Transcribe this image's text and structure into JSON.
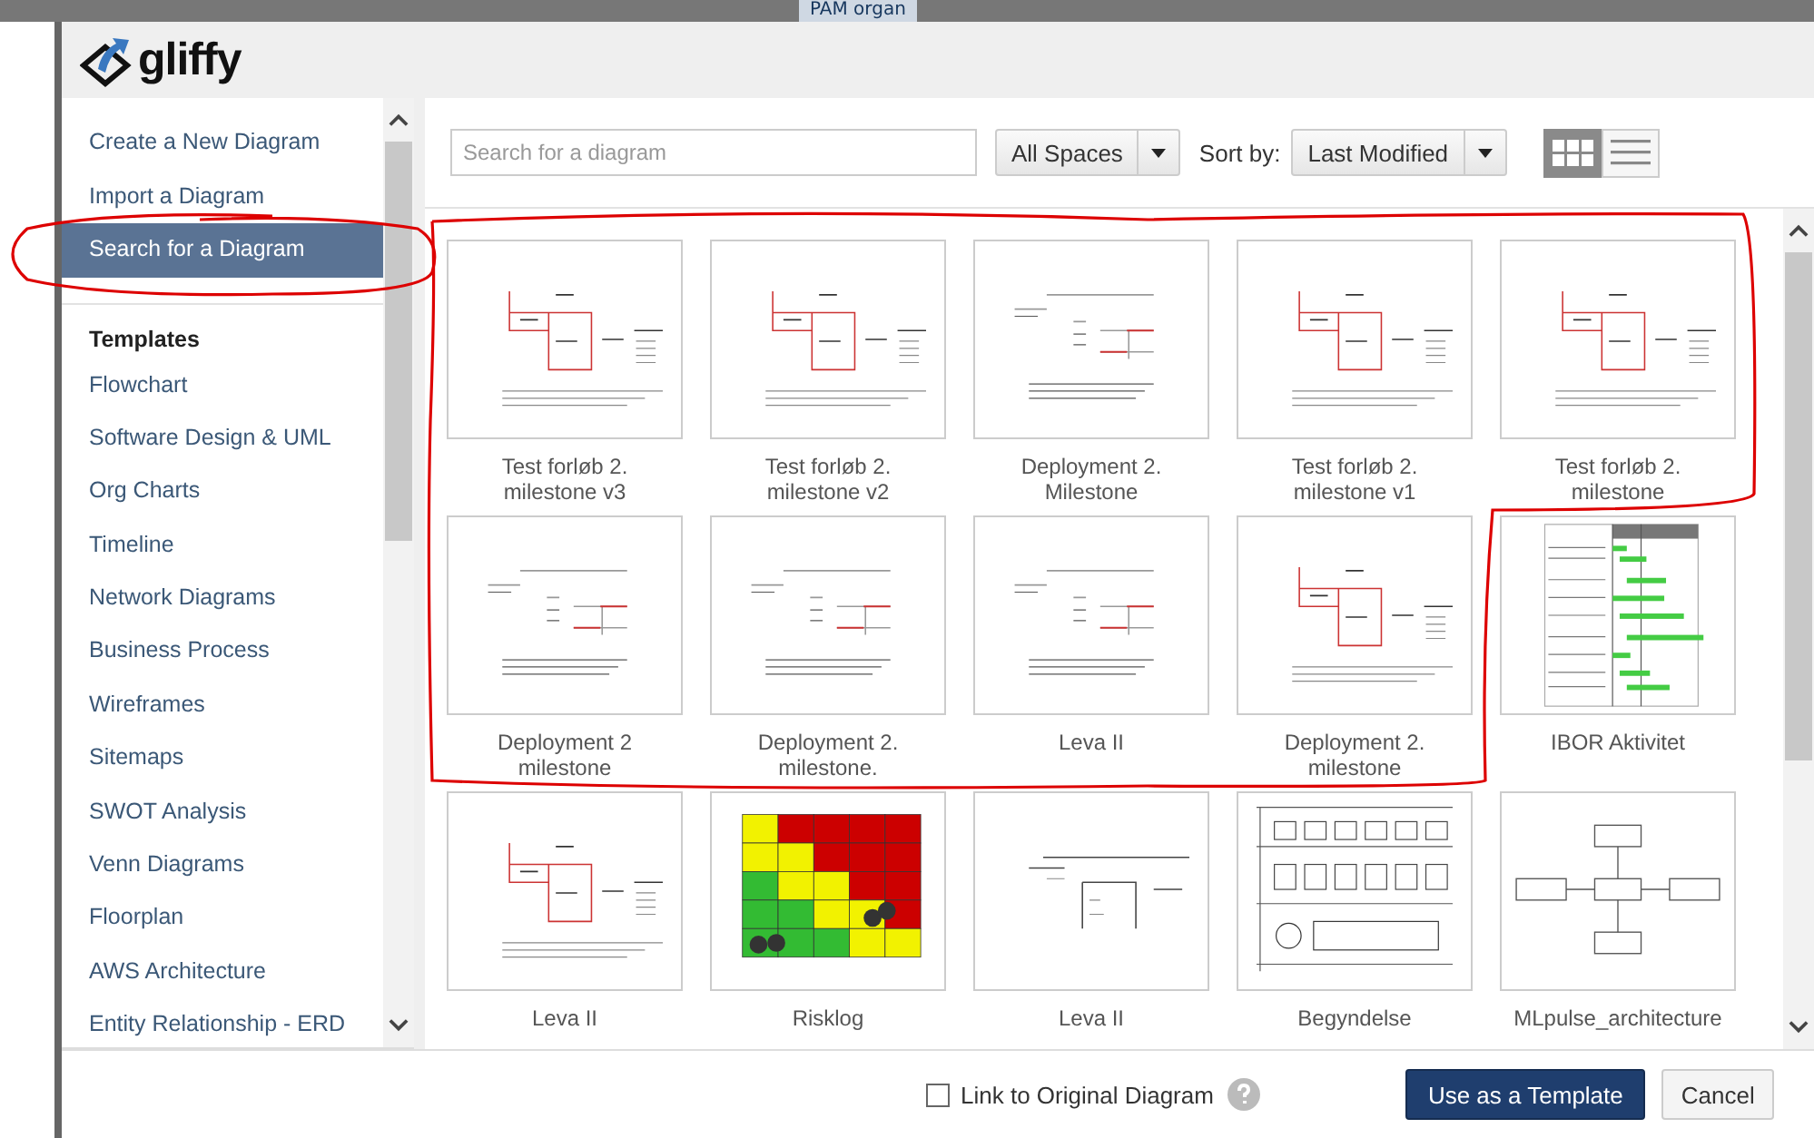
{
  "background": {
    "text": "PAM organ"
  },
  "logo": {
    "text": "gliffy"
  },
  "sidebar": {
    "items": [
      {
        "label": "Create a New Diagram",
        "selected": false
      },
      {
        "label": "Import a Diagram",
        "selected": false
      },
      {
        "label": "Search for a Diagram",
        "selected": true
      }
    ],
    "templates_heading": "Templates",
    "templates": [
      "Flowchart",
      "Software Design & UML",
      "Org Charts",
      "Timeline",
      "Network Diagrams",
      "Business Process",
      "Wireframes",
      "Sitemaps",
      "SWOT Analysis",
      "Venn Diagrams",
      "Floorplan",
      "AWS Architecture",
      "Entity Relationship - ERD"
    ]
  },
  "toolbar": {
    "search": {
      "placeholder": "Search for a diagram"
    },
    "space": "All Spaces",
    "sort_label": "Sort by:",
    "sort": "Last Modified",
    "views": [
      {
        "kind": "grid",
        "selected": true
      },
      {
        "kind": "list",
        "selected": false
      }
    ]
  },
  "diagrams": [
    {
      "title": "Test forløb 2. milestone v3",
      "kind": "sketch"
    },
    {
      "title": "Test forløb 2. milestone v2",
      "kind": "sketch"
    },
    {
      "title": "Deployment 2. Milestone",
      "kind": "plan"
    },
    {
      "title": "Test forløb 2. milestone v1",
      "kind": "sketch"
    },
    {
      "title": "Test forløb 2. milestone",
      "kind": "sketch"
    },
    {
      "title": "Deployment 2 milestone",
      "kind": "plan"
    },
    {
      "title": "Deployment 2. milestone.",
      "kind": "plan"
    },
    {
      "title": "Leva II",
      "kind": "plan"
    },
    {
      "title": "Deployment 2. milestone",
      "kind": "sketch"
    },
    {
      "title": "IBOR Aktivitet",
      "kind": "gantt"
    },
    {
      "title": "Leva II",
      "kind": "sketch"
    },
    {
      "title": "Risklog",
      "kind": "heatmap"
    },
    {
      "title": "Leva II",
      "kind": "layout"
    },
    {
      "title": "Begyndelse",
      "kind": "grid"
    },
    {
      "title": "MLpulse_architecture",
      "kind": "blocks"
    }
  ],
  "footer": {
    "link_checkbox": {
      "label": "Link to Original Diagram",
      "checked": false
    },
    "primary": "Use as a Template",
    "cancel": "Cancel"
  },
  "annotations": [
    {
      "kind": "loop"
    },
    {
      "kind": "loop"
    }
  ]
}
